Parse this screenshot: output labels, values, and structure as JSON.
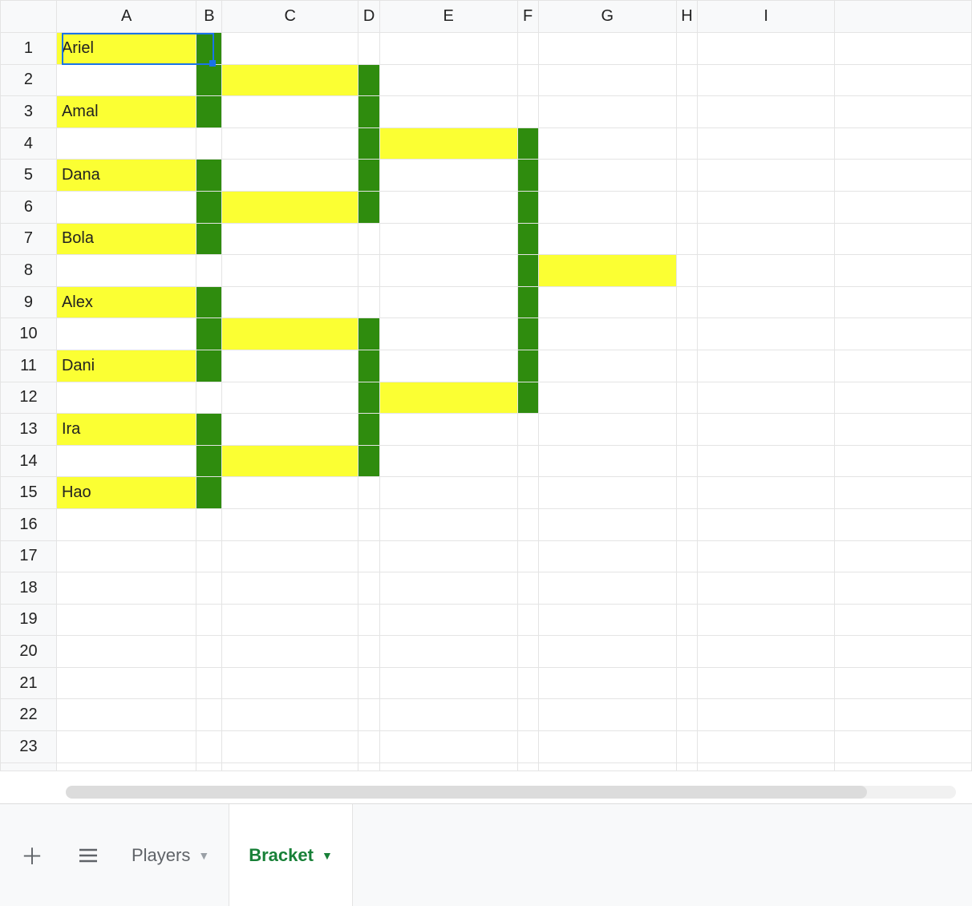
{
  "columns": [
    "A",
    "B",
    "C",
    "D",
    "E",
    "F",
    "G",
    "H",
    "I"
  ],
  "rowCount": 23,
  "selected": {
    "row": 1,
    "col": "A"
  },
  "cells": {
    "A1": {
      "text": "Ariel",
      "fill": "yellow"
    },
    "B1": {
      "fill": "green"
    },
    "B2": {
      "fill": "green"
    },
    "C2": {
      "fill": "yellow"
    },
    "D2": {
      "fill": "green"
    },
    "A3": {
      "text": "Amal",
      "fill": "yellow"
    },
    "B3": {
      "fill": "green"
    },
    "D3": {
      "fill": "green"
    },
    "D4": {
      "fill": "green"
    },
    "E4": {
      "fill": "yellow"
    },
    "F4": {
      "fill": "green"
    },
    "A5": {
      "text": "Dana",
      "fill": "yellow"
    },
    "B5": {
      "fill": "green"
    },
    "D5": {
      "fill": "green"
    },
    "F5": {
      "fill": "green"
    },
    "B6": {
      "fill": "green"
    },
    "C6": {
      "fill": "yellow"
    },
    "D6": {
      "fill": "green"
    },
    "F6": {
      "fill": "green"
    },
    "A7": {
      "text": "Bola",
      "fill": "yellow"
    },
    "B7": {
      "fill": "green"
    },
    "F7": {
      "fill": "green"
    },
    "F8": {
      "fill": "green"
    },
    "G8": {
      "fill": "yellow"
    },
    "A9": {
      "text": "Alex",
      "fill": "yellow"
    },
    "B9": {
      "fill": "green"
    },
    "F9": {
      "fill": "green"
    },
    "B10": {
      "fill": "green"
    },
    "C10": {
      "fill": "yellow"
    },
    "D10": {
      "fill": "green"
    },
    "F10": {
      "fill": "green"
    },
    "A11": {
      "text": "Dani",
      "fill": "yellow"
    },
    "B11": {
      "fill": "green"
    },
    "D11": {
      "fill": "green"
    },
    "F11": {
      "fill": "green"
    },
    "D12": {
      "fill": "green"
    },
    "E12": {
      "fill": "yellow"
    },
    "F12": {
      "fill": "green"
    },
    "A13": {
      "text": "Ira",
      "fill": "yellow"
    },
    "B13": {
      "fill": "green"
    },
    "D13": {
      "fill": "green"
    },
    "B14": {
      "fill": "green"
    },
    "C14": {
      "fill": "yellow"
    },
    "D14": {
      "fill": "green"
    },
    "A15": {
      "text": "Hao",
      "fill": "yellow"
    },
    "B15": {
      "fill": "green"
    }
  },
  "tabs": {
    "items": [
      {
        "label": "Players",
        "active": false
      },
      {
        "label": "Bracket",
        "active": true
      }
    ]
  }
}
